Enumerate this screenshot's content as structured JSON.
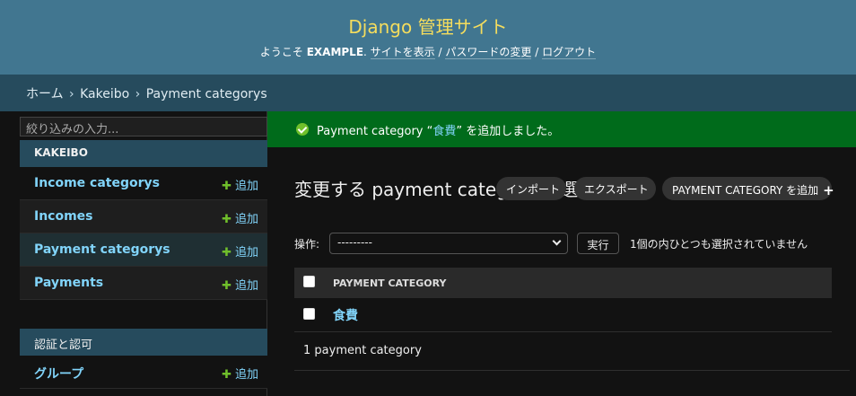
{
  "header": {
    "site_name": "Django 管理サイト",
    "welcome": "ようこそ",
    "username": "EXAMPLE",
    "view_site": "サイトを表示",
    "change_password": "パスワードの変更",
    "logout": "ログアウト",
    "separator": "/"
  },
  "breadcrumbs": {
    "home": "ホーム",
    "app": "Kakeibo",
    "current": "Payment categorys",
    "arrow": "›"
  },
  "sidebar": {
    "filter_placeholder": "絞り込みの入力...",
    "apps": [
      {
        "caption": "KAKEIBO",
        "models": [
          {
            "name": "Income categorys",
            "add": "追加"
          },
          {
            "name": "Incomes",
            "add": "追加"
          },
          {
            "name": "Payment categorys",
            "add": "追加"
          },
          {
            "name": "Payments",
            "add": "追加"
          }
        ]
      },
      {
        "caption": "認証と認可",
        "models": [
          {
            "name": "グループ",
            "add": "追加"
          }
        ]
      }
    ]
  },
  "message": {
    "prefix": "Payment category “",
    "object": "食費",
    "suffix": "” を追加しました。"
  },
  "content": {
    "title": "変更する payment category を選択",
    "import_button": "インポート",
    "export_button": "エクスポート",
    "add_button": "PAYMENT CATEGORY を追加",
    "add_plus": "+",
    "actions_label": "操作:",
    "action_selected": "---------",
    "go_button": "実行",
    "action_counter": "1個の内ひとつも選択されていません",
    "column_header": "PAYMENT CATEGORY",
    "rows": [
      {
        "name": "食費"
      }
    ],
    "paginator": "1 payment category"
  },
  "colors": {
    "header_bg": "#417690",
    "site_name": "#f5dd5d",
    "breadcrumbs_bg": "#264b5d",
    "success_bg": "#006b1b",
    "link": "#81d4fa",
    "add_green": "#70bf2b"
  }
}
